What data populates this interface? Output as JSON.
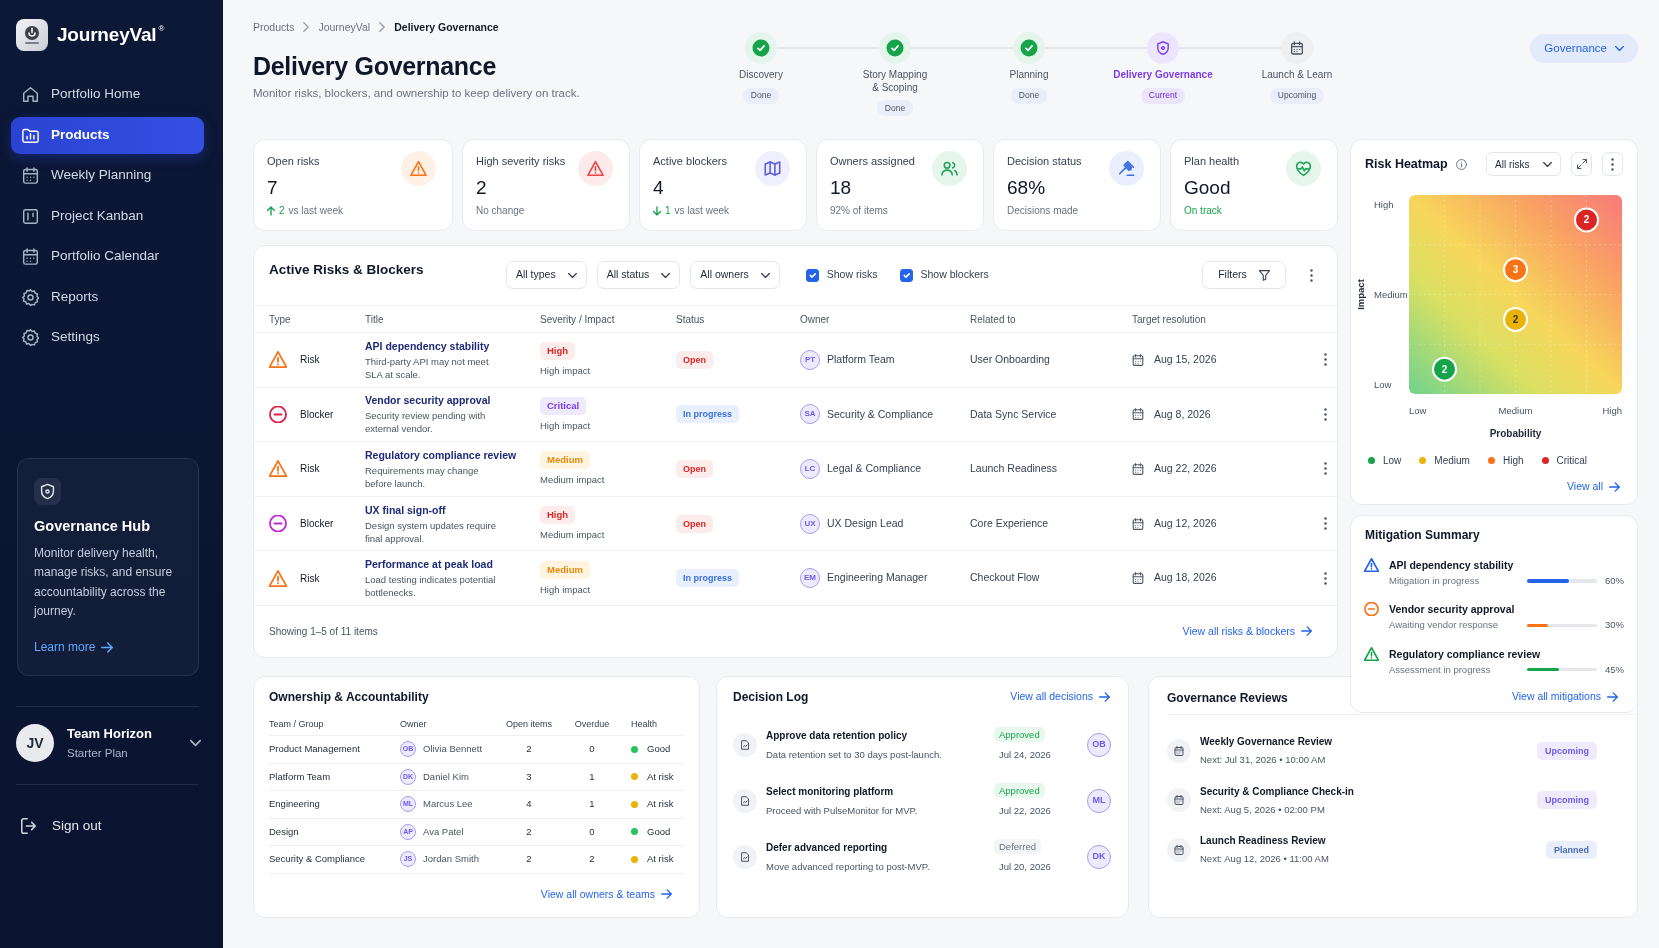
{
  "sidebar": {
    "brand": "JourneyVal$^{®}$",
    "items": [
      {
        "label": "Portfolio Home",
        "selected": false
      },
      {
        "label": "Products",
        "selected": true
      },
      {
        "label": "Weekly Planning",
        "selected": false
      },
      {
        "label": "Project Kanban",
        "selected": false
      },
      {
        "label": "Portfolio Calendar",
        "selected": false
      },
      {
        "label": "Reports",
        "selected": false
      },
      {
        "label": "Settings",
        "selected": false
      }
    ],
    "promo": {
      "title": "Governance Hub",
      "text": "Monitor delivery health, manage risks, and ensure accountability across the journey.",
      "link": "Learn more"
    },
    "user": {
      "initials": "JV",
      "name": "Team Horizon",
      "plan": "Starter Plan"
    },
    "sign_out": "Sign out"
  },
  "breadcrumb": [
    {
      "label": "Products",
      "current": false
    },
    {
      "label": "JourneyVal",
      "current": false
    },
    {
      "label": "Delivery Governance",
      "current": true
    }
  ],
  "page": {
    "title": "Delivery Governance",
    "subtitle": "Monitor risks, blockers, and ownership to keep delivery on track."
  },
  "steps": [
    {
      "label": "Discovery",
      "status": "Done",
      "kind": "done"
    },
    {
      "label": "Story Mapping\n& Scoping",
      "status": "Done",
      "kind": "done"
    },
    {
      "label": "Planning",
      "status": "Done",
      "kind": "done"
    },
    {
      "label": "Delivery Governance",
      "status": "Current",
      "kind": "current"
    },
    {
      "label": "Launch & Learn",
      "status": "Upcoming",
      "kind": "upcoming"
    }
  ],
  "phase_button": "Governance",
  "kpis": [
    {
      "label": "Open risks",
      "value": "7",
      "kind": "up",
      "change": "2",
      "note": "vs last week",
      "positive": false
    },
    {
      "label": "High severity risks",
      "value": "2",
      "kind": "plain",
      "note": "No change",
      "positive": false
    },
    {
      "label": "Active blockers",
      "value": "4",
      "kind": "down",
      "change": "1",
      "note": "vs last week",
      "positive": false
    },
    {
      "label": "Owners assigned",
      "value": "18",
      "kind": "plain",
      "note": "92% of items",
      "positive": false
    },
    {
      "label": "Decision status",
      "value": "68%",
      "kind": "plain",
      "note": "Decisions made",
      "positive": false
    },
    {
      "label": "Plan health",
      "value": "Good",
      "kind": "plain",
      "note": "On track",
      "positive": true
    }
  ],
  "risks": {
    "title": "Active Risks & Blockers",
    "filters": [
      "All types",
      "All status",
      "All owners"
    ],
    "toggles": [
      {
        "label": "Show risks",
        "checked": true
      },
      {
        "label": "Show blockers",
        "checked": true
      }
    ],
    "filters_button": "Filters",
    "columns": [
      "Type",
      "Title",
      "Severity / Impact",
      "Status",
      "Owner",
      "Related to",
      "Target resolution"
    ],
    "rows": [
      {
        "kind": "risk",
        "type": "Risk",
        "color": "#f97316",
        "title": "API dependency stability",
        "description": "Third-party API may not meet SLA at scale.",
        "severity": {
          "label": "High",
          "kind": "high"
        },
        "impact": "High impact",
        "status": {
          "label": "Open",
          "kind": "open"
        },
        "owner": {
          "initials": "PT",
          "name": "Platform Team"
        },
        "related": "User Onboarding",
        "target": "Aug 15, 2026"
      },
      {
        "kind": "blocker",
        "type": "Blocker",
        "color": "#e11d48",
        "title": "Vendor security approval",
        "description": "Security review pending with external vendor.",
        "severity": {
          "label": "Critical",
          "kind": "critical"
        },
        "impact": "High impact",
        "status": {
          "label": "In progress",
          "kind": "progress"
        },
        "owner": {
          "initials": "SA",
          "name": "Security & Compliance"
        },
        "related": "Data Sync Service",
        "target": "Aug 8, 2026"
      },
      {
        "kind": "risk",
        "type": "Risk",
        "color": "#f97316",
        "title": "Regulatory compliance review",
        "description": "Requirements may change before launch.",
        "severity": {
          "label": "Medium",
          "kind": "medium"
        },
        "impact": "Medium impact",
        "status": {
          "label": "Open",
          "kind": "open"
        },
        "owner": {
          "initials": "LC",
          "name": "Legal & Compliance"
        },
        "related": "Launch Readiness",
        "target": "Aug 22, 2026"
      },
      {
        "kind": "blocker",
        "type": "Blocker",
        "color": "#c026d3",
        "title": "UX final sign-off",
        "description": "Design system updates require final approval.",
        "severity": {
          "label": "High",
          "kind": "high"
        },
        "impact": "Medium impact",
        "status": {
          "label": "Open",
          "kind": "open"
        },
        "owner": {
          "initials": "UX",
          "name": "UX Design Lead"
        },
        "related": "Core Experience",
        "target": "Aug 12, 2026"
      },
      {
        "kind": "risk",
        "type": "Risk",
        "color": "#f97316",
        "title": "Performance at peak load",
        "description": "Load testing indicates potential bottlenecks.",
        "severity": {
          "label": "Medium",
          "kind": "medium"
        },
        "impact": "High impact",
        "status": {
          "label": "In progress",
          "kind": "progress"
        },
        "owner": {
          "initials": "EM",
          "name": "Engineering Manager"
        },
        "related": "Checkout Flow",
        "target": "Aug 18, 2026"
      }
    ],
    "footer": "Showing 1–5 of 11 items",
    "link": "View all risks & blockers"
  },
  "heatmap": {
    "title": "Risk Heatmap",
    "filter": "All risks",
    "y_title": "Impact",
    "y_labels": [
      "High",
      "Medium",
      "Low"
    ],
    "x_labels": [
      "Low",
      "Medium",
      "High"
    ],
    "x_title": "Probability",
    "bubbles": [
      {
        "label": "2",
        "color": "#dc2626"
      },
      {
        "label": "3",
        "color": "#f97316"
      },
      {
        "label": "2",
        "color": "#eab308"
      },
      {
        "label": "2",
        "color": "#16a34a"
      }
    ],
    "legend": [
      {
        "label": "Low",
        "color": "#16a34a"
      },
      {
        "label": "Medium",
        "color": "#eab308"
      },
      {
        "label": "High",
        "color": "#f97316"
      },
      {
        "label": "Critical",
        "color": "#dc2626"
      }
    ],
    "link": "View all"
  },
  "mitigation": {
    "title": "Mitigation Summary",
    "items": [
      {
        "kind": "risk",
        "color": "#2563eb",
        "title": "API dependency stability",
        "subtitle": "Mitigation in progress",
        "level": 0.6,
        "percent": "60%"
      },
      {
        "kind": "blocker",
        "color": "#f97316",
        "title": "Vendor security approval",
        "subtitle": "Awaiting vendor response",
        "level": 0.3,
        "percent": "30%"
      },
      {
        "kind": "risk",
        "color": "#16a34a",
        "title": "Regulatory compliance review",
        "subtitle": "Assessment in progress",
        "level": 0.45,
        "percent": "45%"
      }
    ],
    "link": "View all mitigations"
  },
  "ownership": {
    "title": "Ownership & Accountability",
    "columns": [
      "Team / Group",
      "Owner",
      "Open items",
      "Overdue",
      "Health"
    ],
    "rows": [
      {
        "team": "Product Management",
        "initials": "OB",
        "owner": "Olivia Bennett",
        "open": "2",
        "overdue": "0",
        "health": "Good",
        "color": "#22c55e"
      },
      {
        "team": "Platform Team",
        "initials": "DK",
        "owner": "Daniel Kim",
        "open": "3",
        "overdue": "1",
        "health": "At risk",
        "color": "#eab308"
      },
      {
        "team": "Engineering",
        "initials": "ML",
        "owner": "Marcus Lee",
        "open": "4",
        "overdue": "1",
        "health": "At risk",
        "color": "#eab308"
      },
      {
        "team": "Design",
        "initials": "AP",
        "owner": "Ava Patel",
        "open": "2",
        "overdue": "0",
        "health": "Good",
        "color": "#22c55e"
      },
      {
        "team": "Security & Compliance",
        "initials": "JS",
        "owner": "Jordan Smith",
        "open": "2",
        "overdue": "2",
        "health": "At risk",
        "color": "#eab308"
      }
    ],
    "link": "View all owners & teams"
  },
  "decisions": {
    "title": "Decision Log",
    "link": "View all decisions",
    "items": [
      {
        "title": "Approve data retention policy",
        "description": "Data retention set to 30 days post-launch.",
        "status": {
          "label": "Approved",
          "kind": "approved"
        },
        "date": "Jul 24, 2026",
        "initials": "OB"
      },
      {
        "title": "Select monitoring platform",
        "description": "Proceed with PulseMonitor for MVP.",
        "status": {
          "label": "Approved",
          "kind": "approved"
        },
        "date": "Jul 22, 2026",
        "initials": "ML"
      },
      {
        "title": "Defer advanced reporting",
        "description": "Move advanced reporting to post-MVP.",
        "status": {
          "label": "Deferred",
          "kind": "deferred"
        },
        "date": "Jul 20, 2026",
        "initials": "DK"
      }
    ]
  },
  "reviews": {
    "title": "Governance Reviews",
    "items": [
      {
        "title": "Weekly Governance Review",
        "schedule": "Next: Jul 31, 2026 • 10:00 AM",
        "status": {
          "label": "Upcoming",
          "kind": "upcoming"
        }
      },
      {
        "title": "Security & Compliance Check-in",
        "schedule": "Next: Aug 5, 2026 • 02:00 PM",
        "status": {
          "label": "Upcoming",
          "kind": "upcoming"
        }
      },
      {
        "title": "Launch Readiness Review",
        "schedule": "Next: Aug 12, 2026 • 11:00 AM",
        "status": {
          "label": "Planned",
          "kind": "planned"
        }
      }
    ]
  }
}
